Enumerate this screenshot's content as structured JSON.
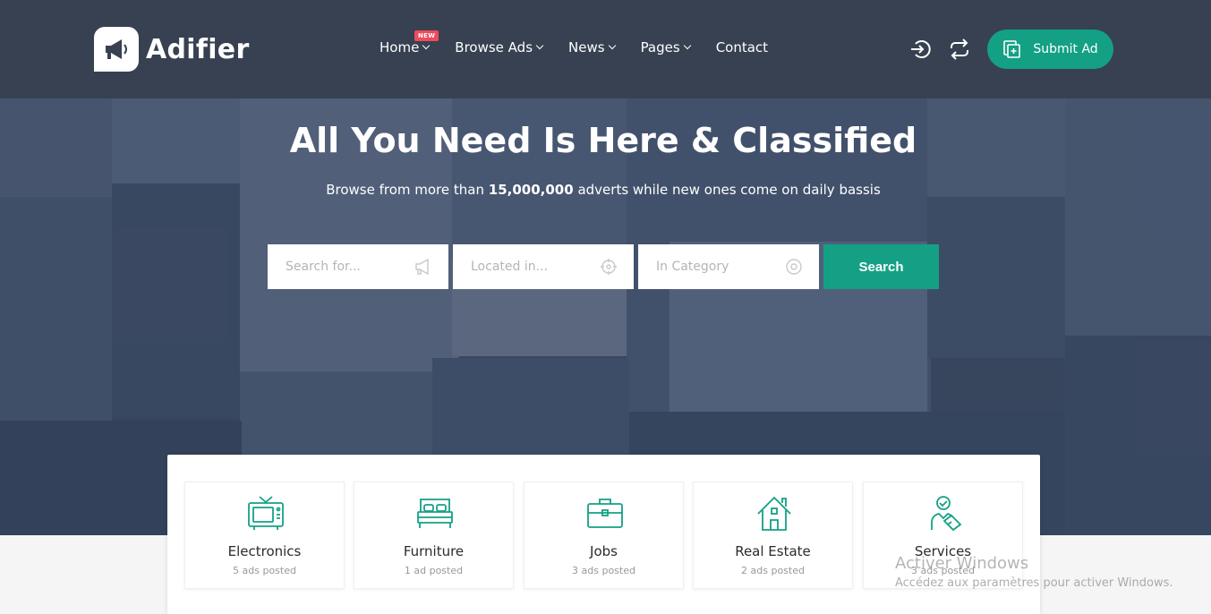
{
  "brand": {
    "name": "Adifier",
    "accent": "#14a085",
    "header_bg": "#374151",
    "badge_color": "#ef4b5c"
  },
  "nav": {
    "items": [
      {
        "label": "Home",
        "badge": "NEW",
        "dropdown": true
      },
      {
        "label": "Browse Ads",
        "dropdown": true
      },
      {
        "label": "News",
        "dropdown": true
      },
      {
        "label": "Pages",
        "dropdown": true
      },
      {
        "label": "Contact",
        "dropdown": false
      }
    ]
  },
  "header_actions": {
    "login_icon": "login-icon",
    "compare_icon": "swap-icon",
    "submit_label": "Submit Ad"
  },
  "hero": {
    "title": "All You Need Is Here & Classified",
    "subtitle_before": "Browse from more than",
    "subtitle_count": "15,000,000",
    "subtitle_after": "adverts while new ones come on daily bassis"
  },
  "search": {
    "keyword_placeholder": "Search for...",
    "location_placeholder": "Located in...",
    "category_placeholder": "In Category",
    "button_label": "Search"
  },
  "categories": [
    {
      "name": "Electronics",
      "count": "5 ads posted",
      "icon": "tv-icon"
    },
    {
      "name": "Furniture",
      "count": "1 ad posted",
      "icon": "bed-icon"
    },
    {
      "name": "Jobs",
      "count": "3 ads posted",
      "icon": "briefcase-icon"
    },
    {
      "name": "Real Estate",
      "count": "2 ads posted",
      "icon": "house-icon"
    },
    {
      "name": "Services",
      "count": "3 ads posted",
      "icon": "service-person-icon"
    }
  ],
  "watermark": {
    "line1": "Activer Windows",
    "line2": "Accédez aux paramètres pour activer Windows."
  }
}
